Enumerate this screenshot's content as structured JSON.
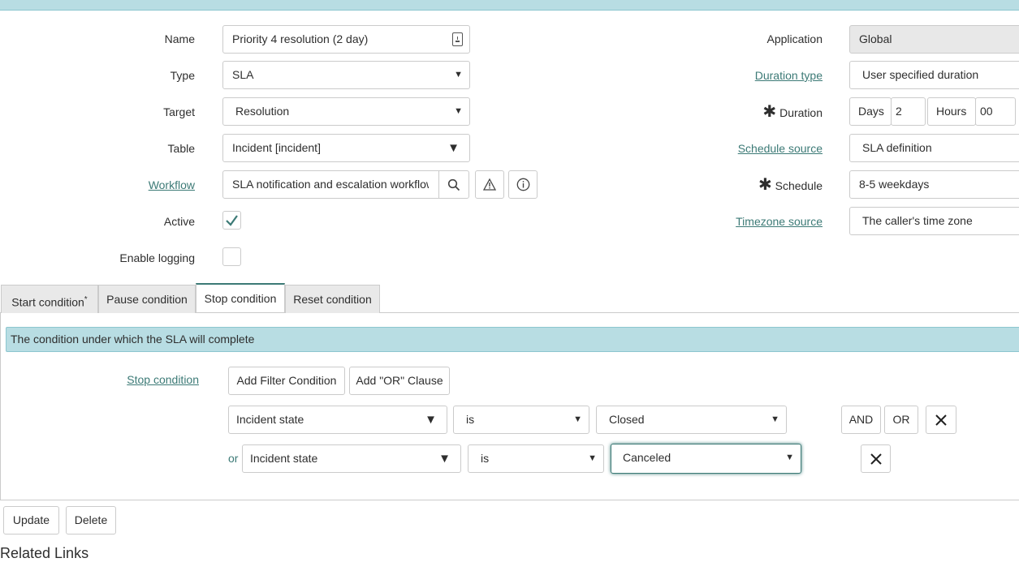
{
  "form": {
    "name_label": "Name",
    "name_value": "Priority 4 resolution (2 day)",
    "type_label": "Type",
    "type_value": "SLA",
    "target_label": "Target",
    "target_value": "Resolution",
    "table_label": "Table",
    "table_value": "Incident [incident]",
    "workflow_label": "Workflow",
    "workflow_value": "SLA notification and escalation workflow",
    "active_label": "Active",
    "active_checked": true,
    "logging_label": "Enable logging",
    "logging_checked": false,
    "application_label": "Application",
    "application_value": "Global",
    "duration_type_label": "Duration type",
    "duration_type_value": "User specified duration",
    "duration_label": "Duration",
    "days_label": "Days",
    "days_value": "2",
    "hours_label": "Hours",
    "hours_value": "00",
    "schedule_source_label": "Schedule source",
    "schedule_source_value": "SLA definition",
    "schedule_label": "Schedule",
    "schedule_value": "8-5 weekdays",
    "timezone_source_label": "Timezone source",
    "timezone_source_value": "The caller's time zone"
  },
  "tabs": [
    {
      "label": "Start condition",
      "required": true,
      "active": false
    },
    {
      "label": "Pause condition",
      "active": false
    },
    {
      "label": "Stop condition",
      "active": true
    },
    {
      "label": "Reset condition",
      "active": false
    }
  ],
  "tab_marker": "*",
  "section": {
    "banner": "The condition under which the SLA will complete",
    "condition_label": "Stop condition",
    "add_filter_button": "Add Filter Condition",
    "add_or_button": "Add \"OR\" Clause",
    "rows": [
      {
        "prefix": "",
        "field": "Incident state",
        "operator": "is",
        "value": "Closed"
      },
      {
        "prefix": "or",
        "field": "Incident state",
        "operator": "is",
        "value": "Canceled"
      }
    ],
    "and_button": "AND",
    "or_button": "OR"
  },
  "actions": {
    "update": "Update",
    "delete": "Delete"
  },
  "related_links": "Related Links",
  "colors": {
    "accent": "#3c7a76",
    "banner_bg": "#b8dde3"
  }
}
